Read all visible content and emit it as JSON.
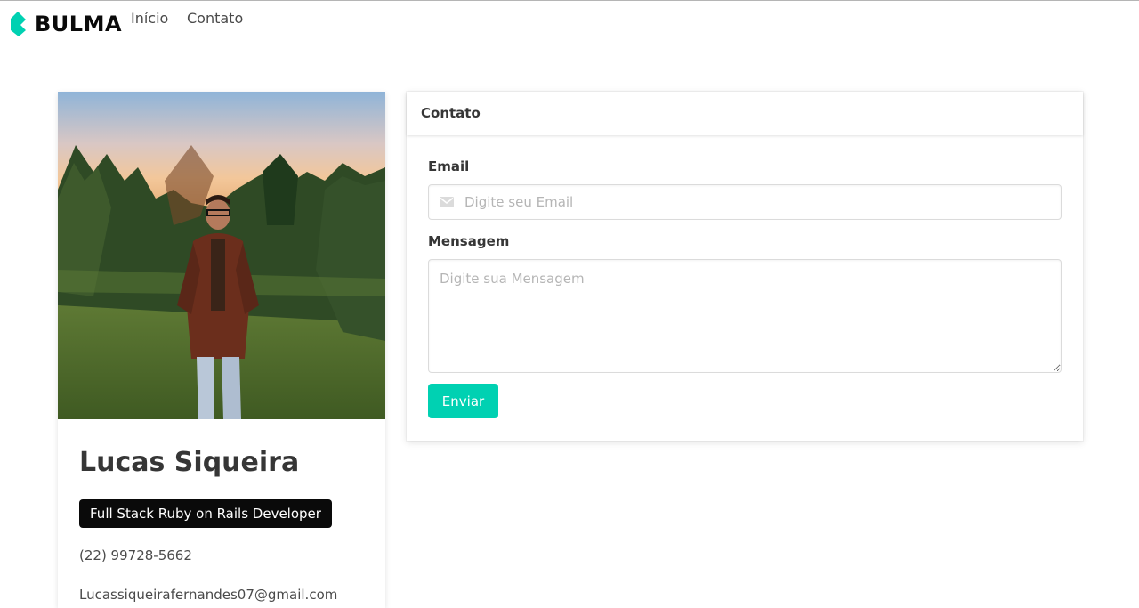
{
  "navbar": {
    "brand": "BULMA",
    "items": [
      {
        "label": "Início"
      },
      {
        "label": "Contato"
      }
    ]
  },
  "profile": {
    "name": "Lucas Siqueira",
    "role": "Full Stack Ruby on Rails Developer",
    "phone": "(22) 99728-5662",
    "email": "Lucassiqueirafernandes07@gmail.com"
  },
  "contact": {
    "title": "Contato",
    "email_label": "Email",
    "email_placeholder": "Digite seu Email",
    "email_value": "",
    "message_label": "Mensagem",
    "message_placeholder": "Digite sua Mensagem",
    "message_value": "",
    "submit_label": "Enviar"
  },
  "colors": {
    "primary": "#00d1b2",
    "dark": "#0a0a0a",
    "text": "#4a4a4a",
    "heading": "#363636"
  },
  "icons": {
    "brand": "bulma-logo-icon",
    "email_field": "envelope-icon"
  }
}
